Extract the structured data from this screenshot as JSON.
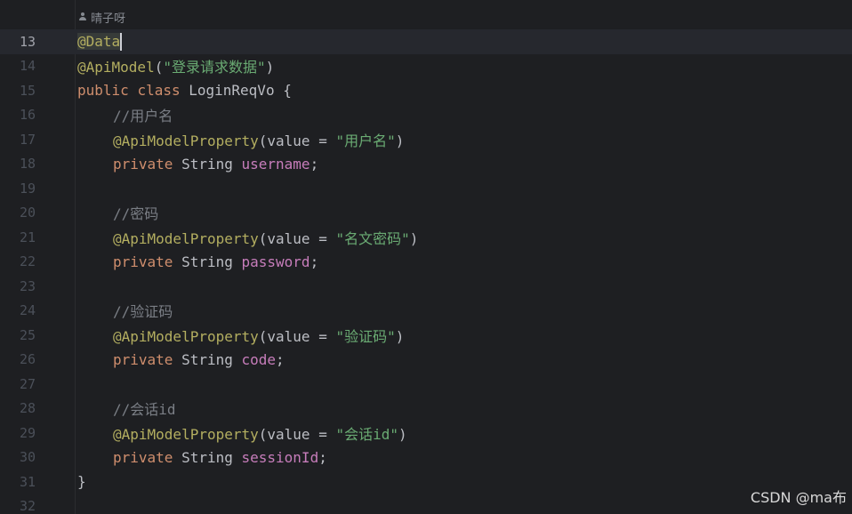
{
  "header": {
    "author": "晴子呀",
    "author_icon": "person-icon"
  },
  "current_line": 13,
  "lines": [
    {
      "number": "13",
      "tokens": [
        {
          "text": "@Data",
          "cls": "ann",
          "highlight": true,
          "caret": true
        }
      ]
    },
    {
      "number": "14",
      "tokens": [
        {
          "text": "@ApiModel",
          "cls": "ann"
        },
        {
          "text": "(",
          "cls": "plain"
        },
        {
          "text": "\"登录请求数据\"",
          "cls": "str"
        },
        {
          "text": ")",
          "cls": "plain"
        }
      ]
    },
    {
      "number": "15",
      "tokens": [
        {
          "text": "public",
          "cls": "kw"
        },
        {
          "text": " ",
          "cls": "plain"
        },
        {
          "text": "class",
          "cls": "kw"
        },
        {
          "text": " LoginReqVo {",
          "cls": "plain"
        }
      ]
    },
    {
      "number": "16",
      "indent": 1,
      "tokens": [
        {
          "text": "//用户名",
          "cls": "com"
        }
      ]
    },
    {
      "number": "17",
      "indent": 1,
      "tokens": [
        {
          "text": "@ApiModelProperty",
          "cls": "ann"
        },
        {
          "text": "(value = ",
          "cls": "plain"
        },
        {
          "text": "\"用户名\"",
          "cls": "str"
        },
        {
          "text": ")",
          "cls": "plain"
        }
      ]
    },
    {
      "number": "18",
      "indent": 1,
      "tokens": [
        {
          "text": "private",
          "cls": "kw"
        },
        {
          "text": " String ",
          "cls": "plain"
        },
        {
          "text": "username",
          "cls": "field"
        },
        {
          "text": ";",
          "cls": "plain"
        }
      ]
    },
    {
      "number": "19",
      "tokens": []
    },
    {
      "number": "20",
      "indent": 1,
      "tokens": [
        {
          "text": "//密码",
          "cls": "com"
        }
      ]
    },
    {
      "number": "21",
      "indent": 1,
      "tokens": [
        {
          "text": "@ApiModelProperty",
          "cls": "ann"
        },
        {
          "text": "(value = ",
          "cls": "plain"
        },
        {
          "text": "\"名文密码\"",
          "cls": "str"
        },
        {
          "text": ")",
          "cls": "plain"
        }
      ]
    },
    {
      "number": "22",
      "indent": 1,
      "tokens": [
        {
          "text": "private",
          "cls": "kw"
        },
        {
          "text": " String ",
          "cls": "plain"
        },
        {
          "text": "password",
          "cls": "field"
        },
        {
          "text": ";",
          "cls": "plain"
        }
      ]
    },
    {
      "number": "23",
      "tokens": []
    },
    {
      "number": "24",
      "indent": 1,
      "tokens": [
        {
          "text": "//验证码",
          "cls": "com"
        }
      ]
    },
    {
      "number": "25",
      "indent": 1,
      "tokens": [
        {
          "text": "@ApiModelProperty",
          "cls": "ann"
        },
        {
          "text": "(value = ",
          "cls": "plain"
        },
        {
          "text": "\"验证码\"",
          "cls": "str"
        },
        {
          "text": ")",
          "cls": "plain"
        }
      ]
    },
    {
      "number": "26",
      "indent": 1,
      "tokens": [
        {
          "text": "private",
          "cls": "kw"
        },
        {
          "text": " String ",
          "cls": "plain"
        },
        {
          "text": "code",
          "cls": "field"
        },
        {
          "text": ";",
          "cls": "plain"
        }
      ]
    },
    {
      "number": "27",
      "tokens": []
    },
    {
      "number": "28",
      "indent": 1,
      "tokens": [
        {
          "text": "//会话id",
          "cls": "com"
        }
      ]
    },
    {
      "number": "29",
      "indent": 1,
      "tokens": [
        {
          "text": "@ApiModelProperty",
          "cls": "ann"
        },
        {
          "text": "(value = ",
          "cls": "plain"
        },
        {
          "text": "\"会话id\"",
          "cls": "str"
        },
        {
          "text": ")",
          "cls": "plain"
        }
      ]
    },
    {
      "number": "30",
      "indent": 1,
      "tokens": [
        {
          "text": "private",
          "cls": "kw"
        },
        {
          "text": " String ",
          "cls": "plain"
        },
        {
          "text": "sessionId",
          "cls": "field"
        },
        {
          "text": ";",
          "cls": "plain"
        }
      ]
    },
    {
      "number": "31",
      "tokens": [
        {
          "text": "}",
          "cls": "plain"
        }
      ]
    },
    {
      "number": "32",
      "tokens": []
    }
  ],
  "watermark": "CSDN @ma布",
  "colors": {
    "background": "#1e1f22",
    "annotation": "#b3ae60",
    "keyword": "#cf8e6d",
    "string": "#6aab73",
    "field": "#c77dbb",
    "comment": "#7a7e85",
    "plain": "#bcbec4"
  }
}
